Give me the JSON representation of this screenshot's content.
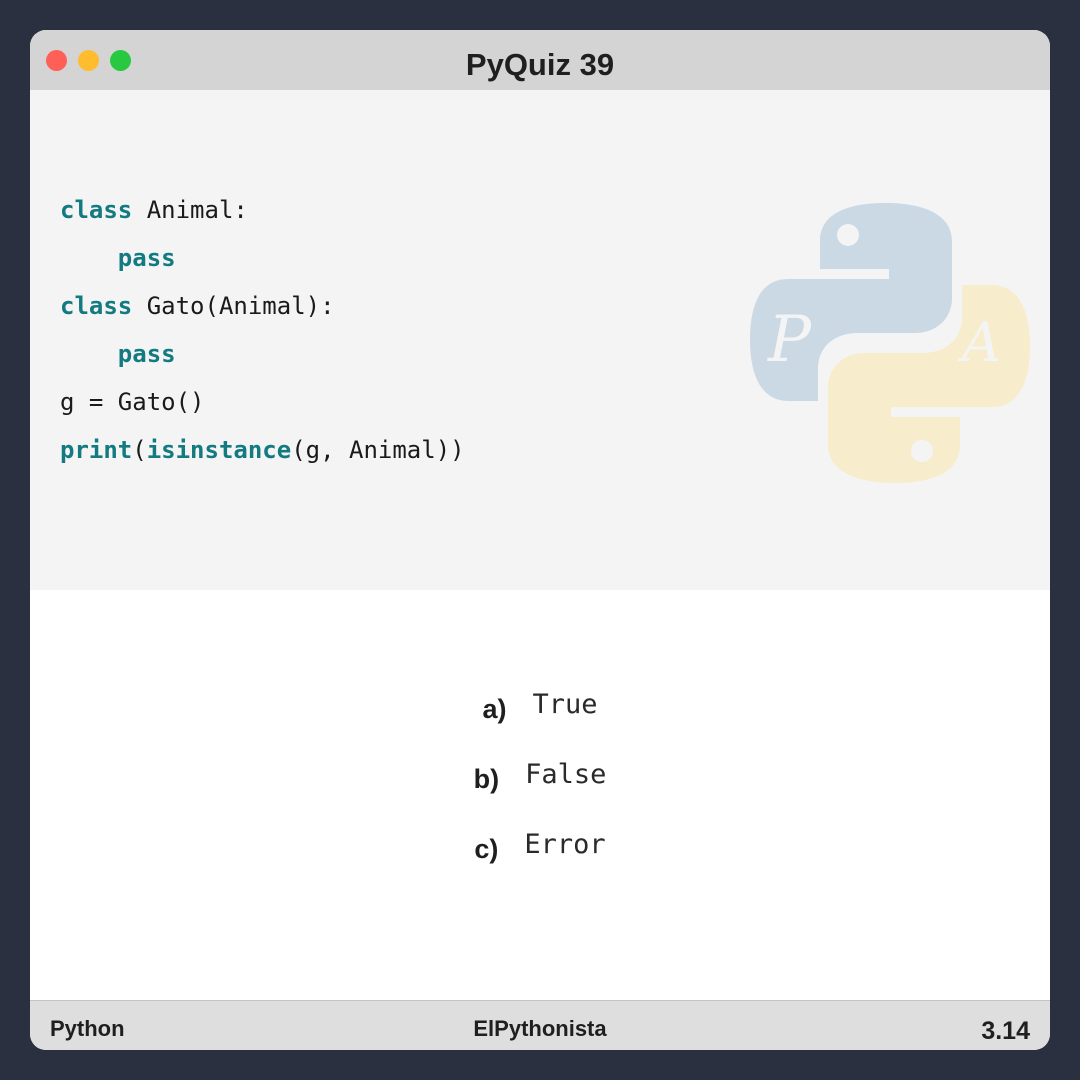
{
  "window": {
    "title": "PyQuiz 39",
    "controls": {
      "close_color": "#fe5f57",
      "minimize_color": "#febc2e",
      "maximize_color": "#28c840"
    }
  },
  "code": {
    "keyword_color": "#127a80",
    "lines": [
      [
        {
          "t": "class",
          "kw": true
        },
        {
          "t": " Animal:"
        }
      ],
      [
        {
          "t": "    "
        },
        {
          "t": "pass",
          "kw": true
        }
      ],
      [
        {
          "t": "class",
          "kw": true
        },
        {
          "t": " Gato(Animal):"
        }
      ],
      [
        {
          "t": "    "
        },
        {
          "t": "pass",
          "kw": true
        }
      ],
      [
        {
          "t": "g = Gato()"
        }
      ],
      [
        {
          "t": "print",
          "kw": true
        },
        {
          "t": "("
        },
        {
          "t": "isinstance",
          "kw": true
        },
        {
          "t": "(g, Animal))"
        }
      ]
    ]
  },
  "logo": {
    "icon": "python-logo-icon",
    "blue": "#cbd9e4",
    "yellow": "#f7edcd",
    "letter_left": "P",
    "letter_right": "A"
  },
  "options": [
    {
      "letter": "a)",
      "text": "True"
    },
    {
      "letter": "b)",
      "text": "False"
    },
    {
      "letter": "c)",
      "text": "Error"
    }
  ],
  "footer": {
    "left": "Python",
    "center": "ElPythonista",
    "right": "3.14"
  }
}
